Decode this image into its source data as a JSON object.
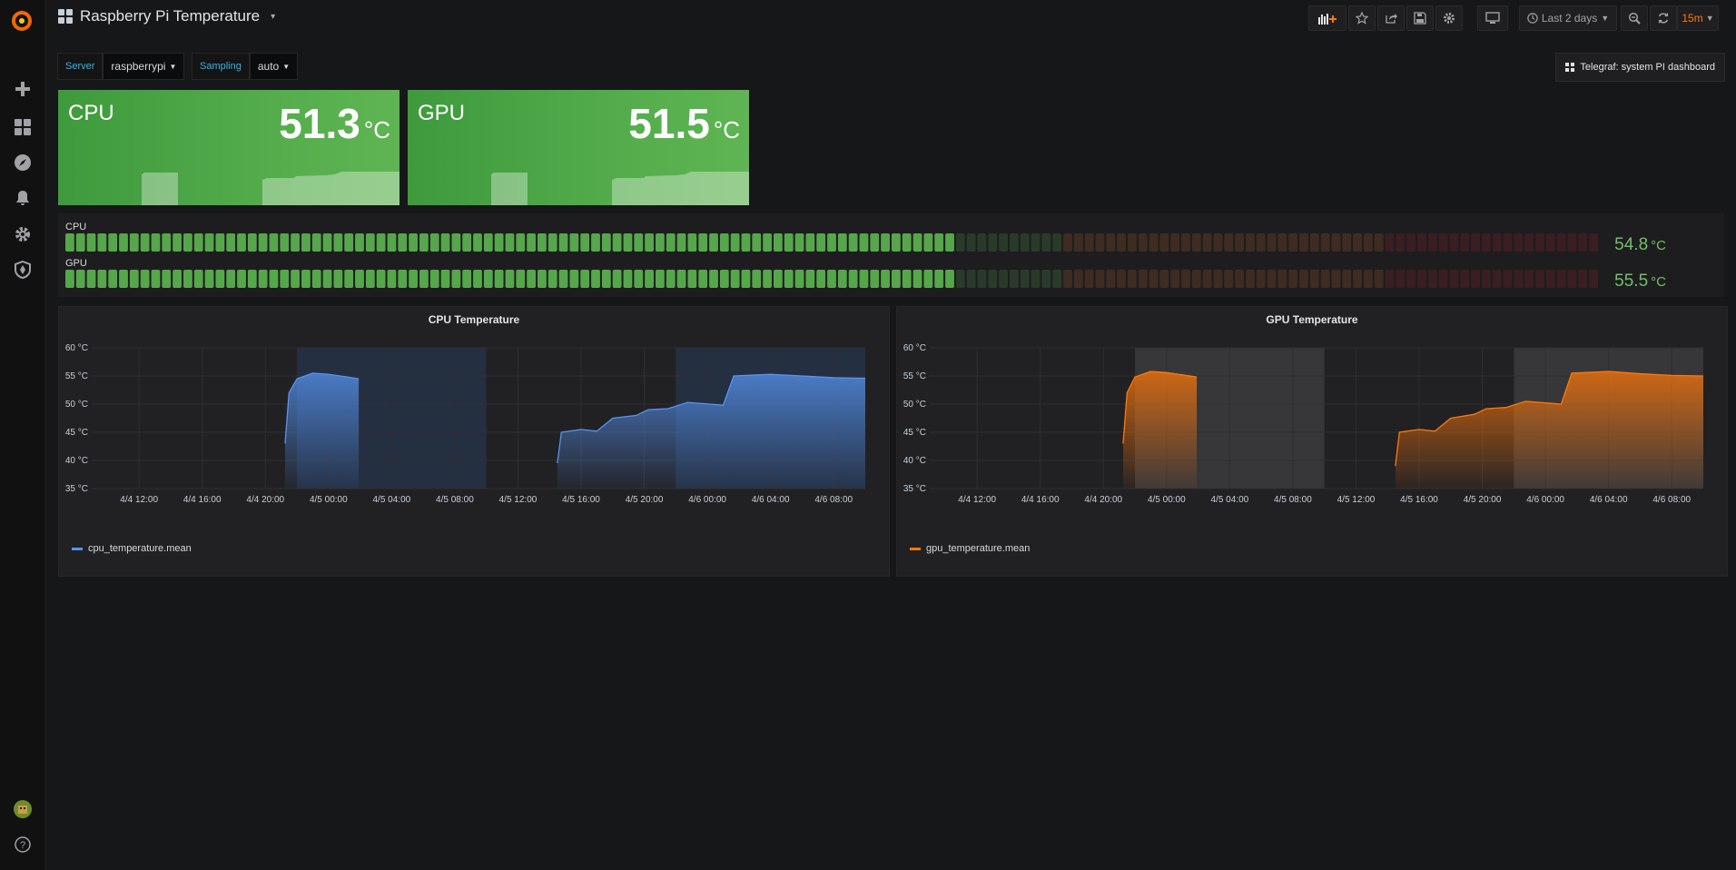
{
  "dashboard": {
    "title": "Raspberry Pi Temperature"
  },
  "toolbar": {
    "time_range": "Last 2 days",
    "refresh_interval": "15m"
  },
  "variables": [
    {
      "label": "Server",
      "value": "raspberrypi"
    },
    {
      "label": "Sampling",
      "value": "auto"
    }
  ],
  "dashboard_link": "Telegraf: system PI dashboard",
  "stats": [
    {
      "title": "CPU",
      "value": "51.3",
      "unit": "°C",
      "color": "#52a748"
    },
    {
      "title": "GPU",
      "value": "51.5",
      "unit": "°C",
      "color": "#52a748"
    }
  ],
  "bar_gauges": [
    {
      "label": "CPU",
      "value": "54.8",
      "unit": "°C",
      "fraction": 0.574
    },
    {
      "label": "GPU",
      "value": "55.5",
      "unit": "°C",
      "fraction": 0.58
    }
  ],
  "chart_data": [
    {
      "type": "area",
      "title": "CPU Temperature",
      "series": [
        {
          "name": "cpu_temperature.mean",
          "color": "#5794f2"
        }
      ],
      "y_ticks": [
        "35 °C",
        "40 °C",
        "45 °C",
        "50 °C",
        "55 °C",
        "60 °C"
      ],
      "x_ticks": [
        "4/4 12:00",
        "4/4 16:00",
        "4/4 20:00",
        "4/5 00:00",
        "4/5 04:00",
        "4/5 08:00",
        "4/5 12:00",
        "4/5 16:00",
        "4/5 20:00",
        "4/6 00:00",
        "4/6 04:00",
        "4/6 08:00"
      ],
      "ylim": [
        35,
        60
      ],
      "points": [
        [
          "4/4 21:15",
          43.0
        ],
        [
          "4/4 21:30",
          52.0
        ],
        [
          "4/4 22:00",
          54.5
        ],
        [
          "4/4 23:00",
          55.5
        ],
        [
          "4/5 00:00",
          55.3
        ],
        [
          "4/5 01:00",
          54.9
        ],
        [
          "4/5 01:55",
          54.5
        ],
        [
          "4/5 14:30",
          39.5
        ],
        [
          "4/5 14:45",
          45.0
        ],
        [
          "4/5 16:00",
          45.5
        ],
        [
          "4/5 17:00",
          45.2
        ],
        [
          "4/5 18:00",
          47.5
        ],
        [
          "4/5 19:30",
          48.0
        ],
        [
          "4/5 20:15",
          49.0
        ],
        [
          "4/5 21:30",
          49.2
        ],
        [
          "4/5 22:45",
          50.3
        ],
        [
          "4/6 01:00",
          49.8
        ],
        [
          "4/6 01:40",
          55.0
        ],
        [
          "4/6 04:00",
          55.3
        ],
        [
          "4/6 06:00",
          55.0
        ],
        [
          "4/6 08:00",
          54.7
        ],
        [
          "4/6 10:00",
          54.6
        ]
      ],
      "shaded_regions": [
        [
          "4/4 22:00",
          "4/5 10:00"
        ],
        [
          "4/5 22:00",
          "4/6 10:00"
        ]
      ]
    },
    {
      "type": "area",
      "title": "GPU Temperature",
      "series": [
        {
          "name": "gpu_temperature.mean",
          "color": "#ff780a"
        }
      ],
      "y_ticks": [
        "35 °C",
        "40 °C",
        "45 °C",
        "50 °C",
        "55 °C",
        "60 °C"
      ],
      "x_ticks": [
        "4/4 12:00",
        "4/4 16:00",
        "4/4 20:00",
        "4/5 00:00",
        "4/5 04:00",
        "4/5 08:00",
        "4/5 12:00",
        "4/5 16:00",
        "4/5 20:00",
        "4/6 00:00",
        "4/6 04:00",
        "4/6 08:00"
      ],
      "ylim": [
        35,
        60
      ],
      "points": [
        [
          "4/4 21:15",
          43.0
        ],
        [
          "4/4 21:30",
          52.0
        ],
        [
          "4/4 22:00",
          54.8
        ],
        [
          "4/4 23:00",
          55.8
        ],
        [
          "4/5 00:00",
          55.6
        ],
        [
          "4/5 01:00",
          55.2
        ],
        [
          "4/5 01:55",
          54.8
        ],
        [
          "4/5 14:30",
          39.0
        ],
        [
          "4/5 14:45",
          45.0
        ],
        [
          "4/5 16:00",
          45.5
        ],
        [
          "4/5 17:00",
          45.2
        ],
        [
          "4/5 18:00",
          47.5
        ],
        [
          "4/5 19:30",
          48.2
        ],
        [
          "4/5 20:15",
          49.2
        ],
        [
          "4/5 21:30",
          49.4
        ],
        [
          "4/5 22:45",
          50.5
        ],
        [
          "4/6 01:00",
          50.0
        ],
        [
          "4/6 01:40",
          55.5
        ],
        [
          "4/6 04:00",
          55.8
        ],
        [
          "4/6 06:00",
          55.4
        ],
        [
          "4/6 08:00",
          55.1
        ],
        [
          "4/6 10:00",
          55.0
        ]
      ],
      "shaded_regions": [
        [
          "4/4 22:00",
          "4/5 10:00"
        ],
        [
          "4/5 22:00",
          "4/6 10:00"
        ]
      ]
    }
  ]
}
